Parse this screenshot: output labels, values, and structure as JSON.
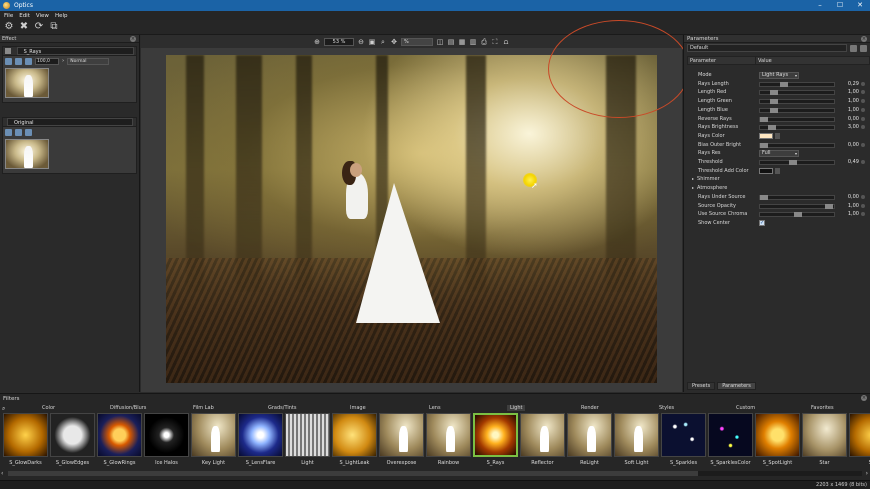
{
  "window": {
    "title": "Optics",
    "controls": [
      "–",
      "☐",
      "✕"
    ]
  },
  "menu": [
    "File",
    "Edit",
    "View",
    "Help"
  ],
  "effect_panel": {
    "title": "Effect",
    "layer_name": "S_Rays",
    "opacity": "100,0",
    "blend_mode": "Normal",
    "original_title": "Original"
  },
  "canvas": {
    "zoom": "53 %",
    "view_select": "%"
  },
  "parameters_panel": {
    "title": "Parameters",
    "preset": "Default",
    "col_parameter": "Parameter",
    "col_value": "Value",
    "rows": [
      {
        "label": "Mode",
        "type": "dropdown",
        "value": "Light Rays"
      },
      {
        "label": "Rays Length",
        "type": "slider",
        "value": "0,29",
        "level": 0.29
      },
      {
        "label": "Length Red",
        "type": "slider",
        "value": "1,00",
        "level": 0.15
      },
      {
        "label": "Length Green",
        "type": "slider",
        "value": "1,00",
        "level": 0.15
      },
      {
        "label": "Length Blue",
        "type": "slider",
        "value": "1,00",
        "level": 0.15
      },
      {
        "label": "Reverse Rays",
        "type": "slider",
        "value": "0,00",
        "level": 0.0
      },
      {
        "label": "Rays Brightness",
        "type": "slider",
        "value": "3,00",
        "level": 0.12
      },
      {
        "label": "Rays Color",
        "type": "color",
        "color": "#ffe7c2"
      },
      {
        "label": "Bias Outer Bright",
        "type": "slider",
        "value": "0,00",
        "level": 0.0
      },
      {
        "label": "Rays Res",
        "type": "dropdown",
        "value": "Full"
      },
      {
        "label": "Threshold",
        "type": "slider",
        "value": "0,49",
        "level": 0.42
      },
      {
        "label": "Threshold Add Color",
        "type": "color",
        "color": "#111111"
      }
    ],
    "groups": [
      "Shimmer",
      "Atmosphere"
    ],
    "atmosphere_rows": [
      {
        "label": "Rays Under Source",
        "value": "0,00",
        "level": 0.0
      },
      {
        "label": "Source Opacity",
        "value": "1,00",
        "level": 0.95
      },
      {
        "label": "Use Source Chroma",
        "value": "1,00",
        "level": 0.5
      }
    ],
    "show_center_label": "Show Center",
    "show_center_checked": true,
    "tabs": [
      "Presets",
      "Parameters"
    ]
  },
  "filters": {
    "title": "Filters",
    "categories": [
      "Color",
      "Diffusion/Blurs",
      "Film Lab",
      "Grads/Tints",
      "Image",
      "Lens",
      "Light",
      "Render",
      "Styles",
      "Custom",
      "Favorites"
    ],
    "active_category": "Light",
    "tiles": [
      {
        "label": "S_GlowDarks",
        "icon": "glowdarks"
      },
      {
        "label": "S_GlowEdges",
        "icon": "saturn"
      },
      {
        "label": "S_GlowRings",
        "icon": "glowrings"
      },
      {
        "label": "Ice Halos",
        "icon": "icehalos"
      },
      {
        "label": "Key Light",
        "icon": "bride"
      },
      {
        "label": "S_LensFlare",
        "icon": "lensflare"
      },
      {
        "label": "Light",
        "icon": "light"
      },
      {
        "label": "S_LightLeak",
        "icon": "lightleak"
      },
      {
        "label": "Overexpose",
        "icon": "bride"
      },
      {
        "label": "Rainbow",
        "icon": "bride"
      },
      {
        "label": "S_Rays",
        "icon": "rays",
        "selected": true
      },
      {
        "label": "Reflector",
        "icon": "bride"
      },
      {
        "label": "ReLight",
        "icon": "bride"
      },
      {
        "label": "Soft Light",
        "icon": "bride"
      },
      {
        "label": "S_Sparkles",
        "icon": "sparkles"
      },
      {
        "label": "S_SparklesColor",
        "icon": "sparklescolor"
      },
      {
        "label": "S_SpotLight",
        "icon": "spotlight"
      },
      {
        "label": "Star",
        "icon": "star"
      },
      {
        "label": "S_",
        "icon": "glowdarks"
      }
    ]
  },
  "status": {
    "resolution": "2203 x 1469 (8 bits)"
  }
}
